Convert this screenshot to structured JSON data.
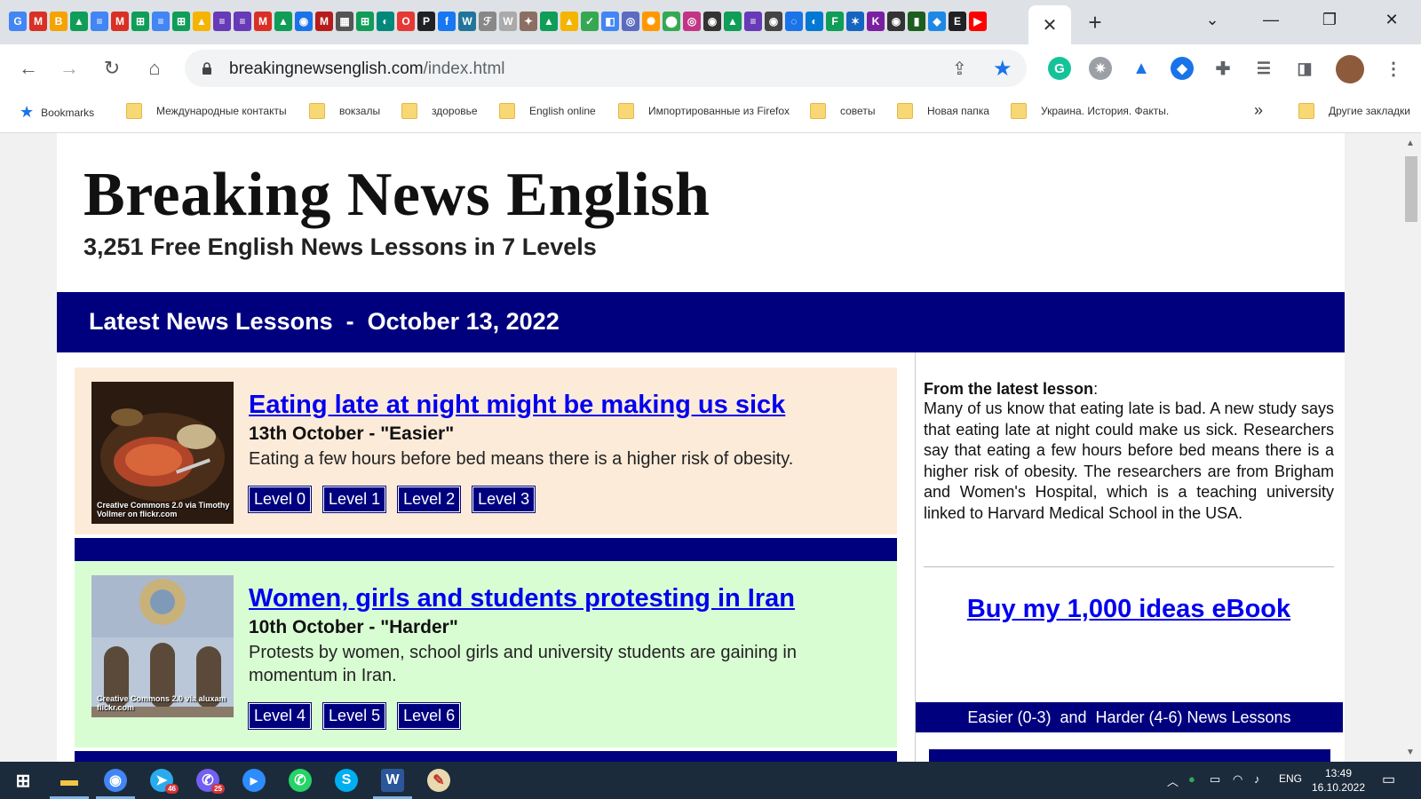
{
  "browser": {
    "tab": {
      "close_glyph": "✕",
      "new_tab_glyph": "+"
    },
    "window_controls": {
      "tab_search": "⌄",
      "minimize": "—",
      "restore": "❐",
      "close": "✕"
    },
    "pinned_tabs": [
      {
        "icon": "google-docs-icon",
        "glyph": "G",
        "color": "#4285f4"
      },
      {
        "icon": "gmail-icon",
        "glyph": "M",
        "color": "#d93025"
      },
      {
        "icon": "blogger-icon",
        "glyph": "B",
        "color": "#f4a300"
      },
      {
        "icon": "google-drive-icon",
        "glyph": "▲",
        "color": "#0f9d58"
      },
      {
        "icon": "docs-icon",
        "glyph": "≡",
        "color": "#4285f4"
      },
      {
        "icon": "gmail-icon",
        "glyph": "M",
        "color": "#d93025"
      },
      {
        "icon": "sheets-icon",
        "glyph": "⊞",
        "color": "#0f9d58"
      },
      {
        "icon": "docs-icon",
        "glyph": "≡",
        "color": "#4285f4"
      },
      {
        "icon": "sheets-icon",
        "glyph": "⊞",
        "color": "#0f9d58"
      },
      {
        "icon": "drive-icon",
        "glyph": "▲",
        "color": "#f4b400"
      },
      {
        "icon": "forms-icon",
        "glyph": "≡",
        "color": "#673ab7"
      },
      {
        "icon": "forms-icon",
        "glyph": "≡",
        "color": "#673ab7"
      },
      {
        "icon": "gmail-icon",
        "glyph": "M",
        "color": "#d93025"
      },
      {
        "icon": "drive-icon",
        "glyph": "▲",
        "color": "#0f9d58"
      },
      {
        "icon": "classroom-icon",
        "glyph": "◉",
        "color": "#1a73e8"
      },
      {
        "icon": "mail-icon",
        "glyph": "M",
        "color": "#b71c1c"
      },
      {
        "icon": "news-icon",
        "glyph": "▦",
        "color": "#555555"
      },
      {
        "icon": "sheets-icon",
        "glyph": "⊞",
        "color": "#0f9d58"
      },
      {
        "icon": "classroom-icon",
        "glyph": "◐",
        "color": "#00897b"
      },
      {
        "icon": "opera-icon",
        "glyph": "O",
        "color": "#e53935"
      },
      {
        "icon": "p-icon",
        "glyph": "P",
        "color": "#202124"
      },
      {
        "icon": "facebook-icon",
        "glyph": "f",
        "color": "#1877f2"
      },
      {
        "icon": "wordpress-icon",
        "glyph": "W",
        "color": "#21759b"
      },
      {
        "icon": "script-icon",
        "glyph": "ℱ",
        "color": "#888888"
      },
      {
        "icon": "wiki-icon",
        "glyph": "W",
        "color": "#aaaaaa"
      },
      {
        "icon": "tools-icon",
        "glyph": "✦",
        "color": "#8d6e63"
      },
      {
        "icon": "drive-icon",
        "glyph": "▲",
        "color": "#0f9d58"
      },
      {
        "icon": "drive-icon",
        "glyph": "▲",
        "color": "#f4b400"
      },
      {
        "icon": "check-icon",
        "glyph": "✓",
        "color": "#34a853"
      },
      {
        "icon": "doc-icon",
        "glyph": "◧",
        "color": "#4285f4"
      },
      {
        "icon": "circle-icon",
        "glyph": "◎",
        "color": "#5c6bc0"
      },
      {
        "icon": "fire-icon",
        "glyph": "✺",
        "color": "#ff9800"
      },
      {
        "icon": "maps-icon",
        "glyph": "⬤",
        "color": "#34a853"
      },
      {
        "icon": "instagram-icon",
        "glyph": "◎",
        "color": "#c13584"
      },
      {
        "icon": "github-icon",
        "glyph": "◉",
        "color": "#333333"
      },
      {
        "icon": "drive-icon",
        "glyph": "▲",
        "color": "#0f9d58"
      },
      {
        "icon": "forms-icon",
        "glyph": "≡",
        "color": "#673ab7"
      },
      {
        "icon": "github-icon",
        "glyph": "◉",
        "color": "#444444"
      },
      {
        "icon": "refresh-icon",
        "glyph": "◌",
        "color": "#1a73e8"
      },
      {
        "icon": "edge-icon",
        "glyph": "◐",
        "color": "#0078d4"
      },
      {
        "icon": "f-icon",
        "glyph": "F",
        "color": "#0f9d58"
      },
      {
        "icon": "ukraine-icon",
        "glyph": "✶",
        "color": "#1565c0"
      },
      {
        "icon": "k-icon",
        "glyph": "K",
        "color": "#7b1fa2"
      },
      {
        "icon": "github-icon",
        "glyph": "◉",
        "color": "#333333"
      },
      {
        "icon": "phone-icon",
        "glyph": "▮",
        "color": "#1b5e20"
      },
      {
        "icon": "drop-icon",
        "glyph": "◆",
        "color": "#1e88e5"
      },
      {
        "icon": "e-icon",
        "glyph": "E",
        "color": "#202124"
      },
      {
        "icon": "youtube-icon",
        "glyph": "▶",
        "color": "#ff0000"
      }
    ],
    "address_bar": {
      "host": "breakingnewsenglish.com",
      "path": "/index.html"
    },
    "bookmarks": [
      {
        "label": "Bookmarks",
        "icon": "star-icon"
      },
      {
        "label": "Международные контакты",
        "icon": "folder-icon"
      },
      {
        "label": "вокзалы",
        "icon": "folder-icon"
      },
      {
        "label": "здоровье",
        "icon": "folder-icon"
      },
      {
        "label": "English online",
        "icon": "folder-icon"
      },
      {
        "label": "Импортированные из Firefox",
        "icon": "folder-icon"
      },
      {
        "label": "советы",
        "icon": "folder-icon"
      },
      {
        "label": "Новая папка",
        "icon": "folder-icon"
      },
      {
        "label": "Украина. История. Факты.",
        "icon": "folder-icon"
      }
    ],
    "bookmarks_more": "»",
    "other_bookmarks": "Другие закладки"
  },
  "site": {
    "title": "Breaking News English",
    "subtitle": "3,251 Free English News Lessons in 7 Levels",
    "latest_bar": "Latest News Lessons  -  October 13, 2022",
    "lessons": [
      {
        "title": "Eating late at night might be making us sick",
        "date": "13th October - \"Easier\"",
        "description": "Eating a few hours before bed means there is a higher risk of obesity.",
        "levels": [
          "Level 0",
          "Level 1",
          "Level 2",
          "Level 3"
        ],
        "thumb_caption": "Creative Commons 2.0 via Timothy Vollmer on flickr.com",
        "bg": "#fdebd9"
      },
      {
        "title": "Women, girls and students protesting in Iran",
        "date": "10th October - \"Harder\"",
        "description": "Protests by women, school girls and university students are gaining in momentum in Iran.",
        "levels": [
          "Level 4",
          "Level 5",
          "Level 6"
        ],
        "thumb_caption": "Creative Commons 2.0 via aluxam flickr.com",
        "bg": "#d9fdd3"
      }
    ],
    "sidebar": {
      "heading": "From the latest lesson",
      "heading_suffix": ":",
      "text": "Many of us know that eating late is bad. A new study says that eating late at night could make us sick. Researchers say that eating a few hours before bed means there is a higher risk of obesity. The researchers are from Brigham and Women's Hospital, which is a teaching university linked to Harvard Medical School in the USA.",
      "ebook_link": "Buy my 1,000 ideas eBook",
      "levels_bar": "Easier (0-3)  and  Harder (4-6) News Lessons"
    },
    "colors": {
      "navy": "#00007f",
      "link": "#0000ee"
    }
  },
  "taskbar": {
    "apps": [
      {
        "name": "windows-start-icon",
        "glyph": "⊞"
      },
      {
        "name": "file-explorer-icon",
        "glyph": "▬"
      },
      {
        "name": "chrome-icon",
        "glyph": "◉"
      },
      {
        "name": "telegram-icon",
        "glyph": "➤",
        "badge": "46"
      },
      {
        "name": "viber-icon",
        "glyph": "✆",
        "badge": "25"
      },
      {
        "name": "zoom-icon",
        "glyph": "▶"
      },
      {
        "name": "whatsapp-icon",
        "glyph": "✆"
      },
      {
        "name": "skype-icon",
        "glyph": "S"
      },
      {
        "name": "word-icon",
        "glyph": "W"
      },
      {
        "name": "paint-icon",
        "glyph": "✎"
      }
    ],
    "tray": {
      "language": "ENG",
      "time": "13:49",
      "date": "16.10.2022"
    }
  }
}
